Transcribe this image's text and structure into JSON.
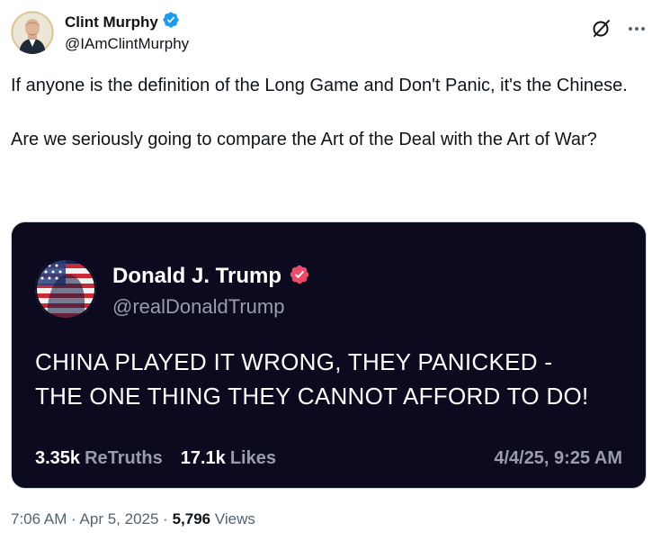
{
  "author": {
    "display_name": "Clint Murphy",
    "handle": "@IAmClintMurphy",
    "avatar_icon": "person-avatar",
    "verified_icon": "verified-badge-icon",
    "verified_color": "#1d9bf0"
  },
  "header_icons": {
    "grok": "grok-icon",
    "more": "more-options-icon"
  },
  "post": {
    "paragraph_1": "If anyone is the definition of the Long Game and Don't Panic, it's the Chinese.",
    "paragraph_2": "Are we seriously going to compare the Art of the Deal with the Art of War?"
  },
  "embedded_card": {
    "background": "#0b0a1f",
    "display_name": "Donald J. Trump",
    "handle": "@realDonaldTrump",
    "verified_color": "#ea4c6a",
    "avatar_icon": "flag-portrait-avatar",
    "text_line_1": "CHINA PLAYED IT WRONG, THEY PANICKED -",
    "text_line_2": "THE ONE THING THEY CANNOT AFFORD TO DO!",
    "retruths_value": "3.35k",
    "retruths_label": "ReTruths",
    "likes_value": "17.1k",
    "likes_label": "Likes",
    "timestamp": "4/4/25, 9:25 AM"
  },
  "meta": {
    "time": "7:06 AM",
    "separator_1": " · ",
    "date": "Apr 5, 2025",
    "separator_2": " · ",
    "views_count": "5,796",
    "views_label": " Views"
  }
}
